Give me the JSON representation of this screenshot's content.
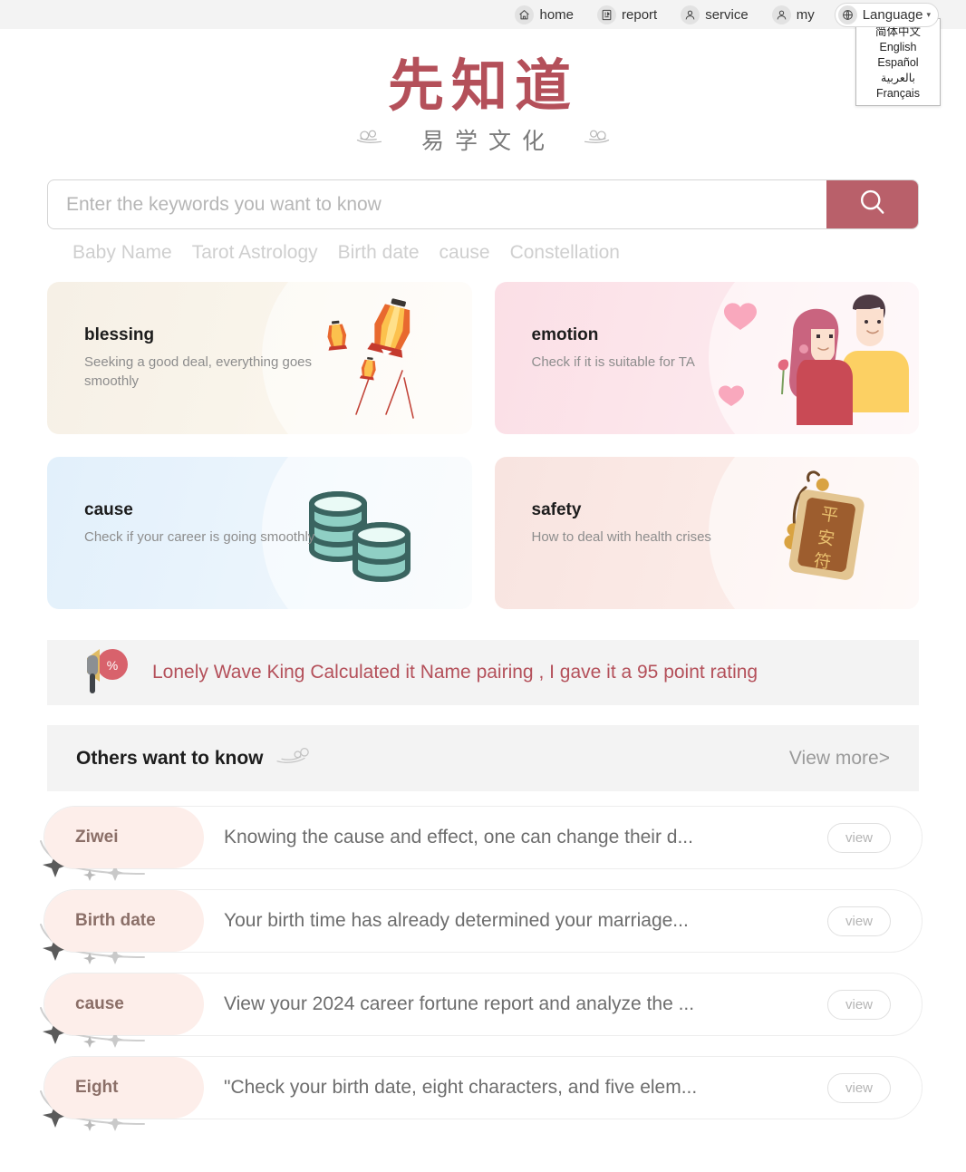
{
  "topnav": {
    "items": [
      {
        "label": "home",
        "icon": "home-icon"
      },
      {
        "label": "report",
        "icon": "report-icon"
      },
      {
        "label": "service",
        "icon": "service-icon"
      },
      {
        "label": "my",
        "icon": "user-icon"
      }
    ],
    "language": {
      "label": "Language",
      "icon": "globe-icon",
      "caret": "▾",
      "open": true,
      "options": [
        "简体中文",
        "English",
        "Español",
        "بالعربية",
        "Français"
      ]
    }
  },
  "logo": {
    "main": "先知道",
    "sub": "易学文化",
    "main_color": "#b4505a",
    "sub_color": "#7b7b7b"
  },
  "search": {
    "placeholder": "Enter the keywords you want to know",
    "value": "",
    "button_icon": "search-icon",
    "button_color": "#b9606a",
    "tags": [
      "Baby Name",
      "Tarot Astrology",
      "Birth date",
      "cause",
      "Constellation"
    ]
  },
  "cards": [
    {
      "title": "blessing",
      "desc": "Seeking a good deal, everything goes smoothly",
      "art": "lanterns-illustration",
      "bg": "#f6f0e6"
    },
    {
      "title": "emotion",
      "desc": "Check if it is suitable for TA",
      "art": "couple-hearts-illustration",
      "bg": "#fbdfe6"
    },
    {
      "title": "cause",
      "desc": "Check if your career is going smoothly",
      "art": "coin-stack-illustration",
      "bg": "#e2f0fb"
    },
    {
      "title": "safety",
      "desc": "How to deal with health crises",
      "art": "amulet-illustration",
      "bg": "#f8e4e0"
    }
  ],
  "announcement": {
    "icon": "megaphone-percent-icon",
    "text": "Lonely Wave King Calculated it   Name pairing  ,   I gave it a 95 point rating",
    "color": "#b4505a"
  },
  "section": {
    "title": "Others want to know",
    "ornament": "cloud-swirl-icon",
    "view_more": "View more",
    "view_more_caret": ">"
  },
  "list": {
    "rows": [
      {
        "tag": "Ziwei",
        "text": "Knowing the cause and effect, one can change their d...",
        "button": "view"
      },
      {
        "tag": "Birth date",
        "text": "Your birth time has already determined your marriage...",
        "button": "view"
      },
      {
        "tag": "cause",
        "text": "View your 2024 career fortune report and analyze the ...",
        "button": "view"
      },
      {
        "tag": "Eight",
        "text": "\"Check your birth date, eight characters, and five elem...",
        "button": "view"
      }
    ]
  }
}
